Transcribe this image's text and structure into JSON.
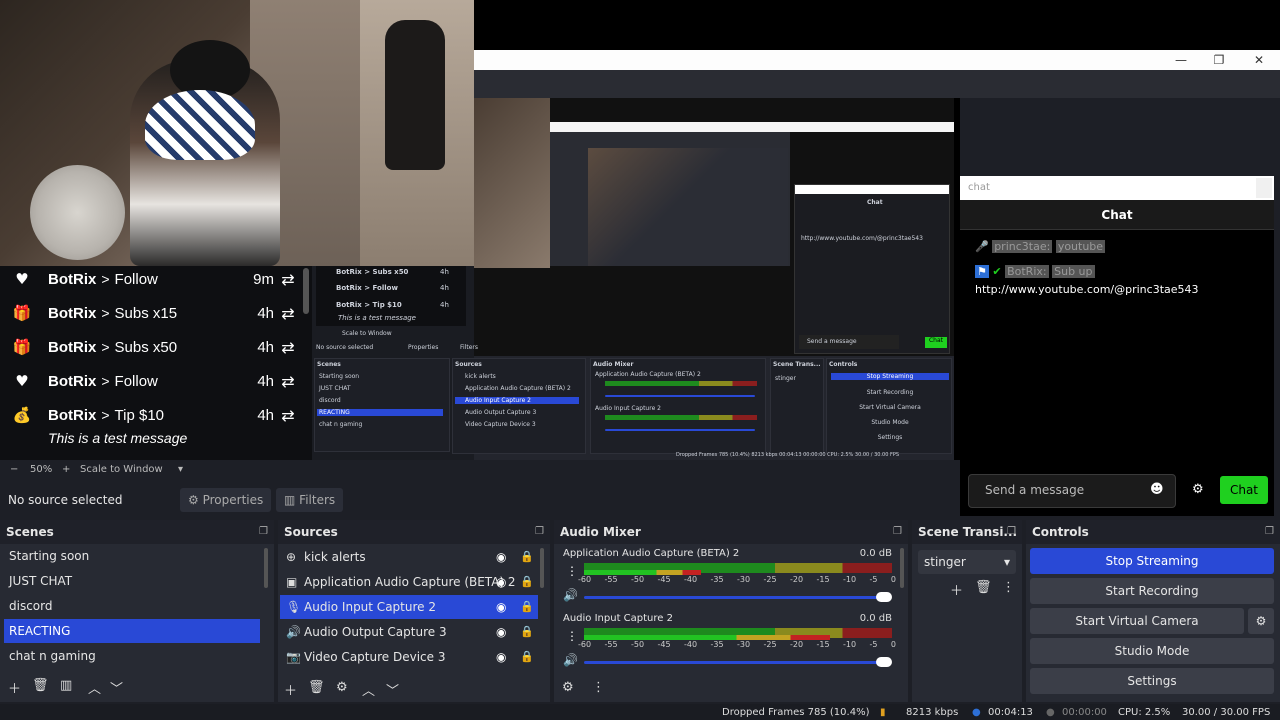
{
  "window": {
    "controls": [
      "—",
      "❐",
      "✕"
    ]
  },
  "alerts": {
    "items": [
      {
        "icon": "♥",
        "user": "BotRix",
        "sep": ">",
        "action": "Follow",
        "time": "9m",
        "repeat": "⇄"
      },
      {
        "icon": "🎁",
        "user": "BotRix",
        "sep": ">",
        "action": "Subs x15",
        "time": "4h",
        "repeat": "⇄"
      },
      {
        "icon": "🎁",
        "user": "BotRix",
        "sep": ">",
        "action": "Subs x50",
        "time": "4h",
        "repeat": "⇄"
      },
      {
        "icon": "♥",
        "user": "BotRix",
        "sep": ">",
        "action": "Follow",
        "time": "4h",
        "repeat": "⇄"
      },
      {
        "icon": "💰",
        "user": "BotRix",
        "sep": ">",
        "action": "Tip $10",
        "time": "4h",
        "repeat": "⇄"
      }
    ],
    "message": "This is a test message"
  },
  "preview_mini": {
    "alerts": [
      "BotRix > Subs x50",
      "BotRix > Follow",
      "BotRix > Tip $10"
    ],
    "alert_times": [
      "4h",
      "4h",
      "4h"
    ],
    "message": "This is a test message",
    "scale": "Scale to Window",
    "no_source": "No source selected",
    "properties": "Properties",
    "filters": "Filters",
    "scenes_title": "Scenes",
    "scenes": [
      "Starting soon",
      "JUST CHAT",
      "discord",
      "REACTING",
      "chat n gaming"
    ],
    "sources_title": "Sources",
    "sources": [
      "kick alerts",
      "Application Audio Capture (BETA) 2",
      "Audio Input Capture 2",
      "Audio Output Capture 3",
      "Video Capture Device 3"
    ],
    "mixer_title": "Audio Mixer",
    "mixer": [
      "Application Audio Capture (BETA) 2",
      "Audio Input Capture 2"
    ],
    "trans_title": "Scene Trans...",
    "trans_value": "stinger",
    "controls_title": "Controls",
    "controls": [
      "Stop Streaming",
      "Start Recording",
      "Start Virtual Camera",
      "Studio Mode",
      "Settings"
    ],
    "chat_title": "Chat",
    "chat_url": "http://www.youtube.com/@princ3tae543",
    "chat_placeholder": "Send a message",
    "chat_send": "Chat",
    "status": "Dropped Frames 785 (10.4%)   8213 kbps   00:04:13   00:00:00   CPU: 2.5%   30.00 / 30.00 FPS"
  },
  "chat": {
    "tab_label": "chat",
    "header": "Chat",
    "lines": [
      {
        "icon": "🎤",
        "user": "princ3tae:",
        "text": "youtube"
      },
      {
        "icon": "✔",
        "user": "BotRix:",
        "text": "Sub up"
      }
    ],
    "url": "http://www.youtube.com/@princ3tae543",
    "input_placeholder": "Send a message",
    "send_label": "Chat"
  },
  "scale_bar": {
    "zoom_minus": "−",
    "zoom": "50%",
    "zoom_plus": "+",
    "scale_mode": "Scale to Window"
  },
  "source_toolbar": {
    "label": "No source selected",
    "properties": "Properties",
    "filters": "Filters"
  },
  "scenes": {
    "title": "Scenes",
    "items": [
      "Starting soon",
      "JUST CHAT",
      "discord",
      "REACTING",
      "chat n gaming"
    ],
    "selected_index": 3
  },
  "sources": {
    "title": "Sources",
    "items": [
      {
        "icon": "⊕",
        "name": "kick alerts"
      },
      {
        "icon": "▣",
        "name": "Application Audio Capture (BETA) 2"
      },
      {
        "icon": "🎙",
        "name": "Audio Input Capture 2"
      },
      {
        "icon": "🔊",
        "name": "Audio Output Capture 3"
      },
      {
        "icon": "📷",
        "name": "Video Capture Device 3"
      }
    ],
    "selected_index": 2
  },
  "mixer": {
    "title": "Audio Mixer",
    "channels": [
      {
        "name": "Application Audio Capture (BETA) 2",
        "db": "0.0 dB",
        "level": 0.38,
        "volume": 1.0
      },
      {
        "name": "Audio Input Capture 2",
        "db": "0.0 dB",
        "level": 0.8,
        "volume": 1.0
      }
    ],
    "ticks": [
      "-60",
      "-55",
      "-50",
      "-45",
      "-40",
      "-35",
      "-30",
      "-25",
      "-20",
      "-15",
      "-10",
      "-5",
      "0"
    ]
  },
  "transitions": {
    "title": "Scene Transi...",
    "selected": "stinger"
  },
  "controls": {
    "title": "Controls",
    "stop_streaming": "Stop Streaming",
    "start_recording": "Start Recording",
    "start_virtual_camera": "Start Virtual Camera",
    "studio_mode": "Studio Mode",
    "settings": "Settings"
  },
  "status": {
    "dropped": "Dropped Frames 785 (10.4%)",
    "kbps": "8213 kbps",
    "live_time": "00:04:13",
    "rec_time": "00:00:00",
    "cpu": "CPU: 2.5%",
    "fps": "30.00 / 30.00 FPS"
  },
  "colors": {
    "accent": "#2949d6",
    "chat_send": "#1fd01f",
    "panel": "#272a33"
  }
}
